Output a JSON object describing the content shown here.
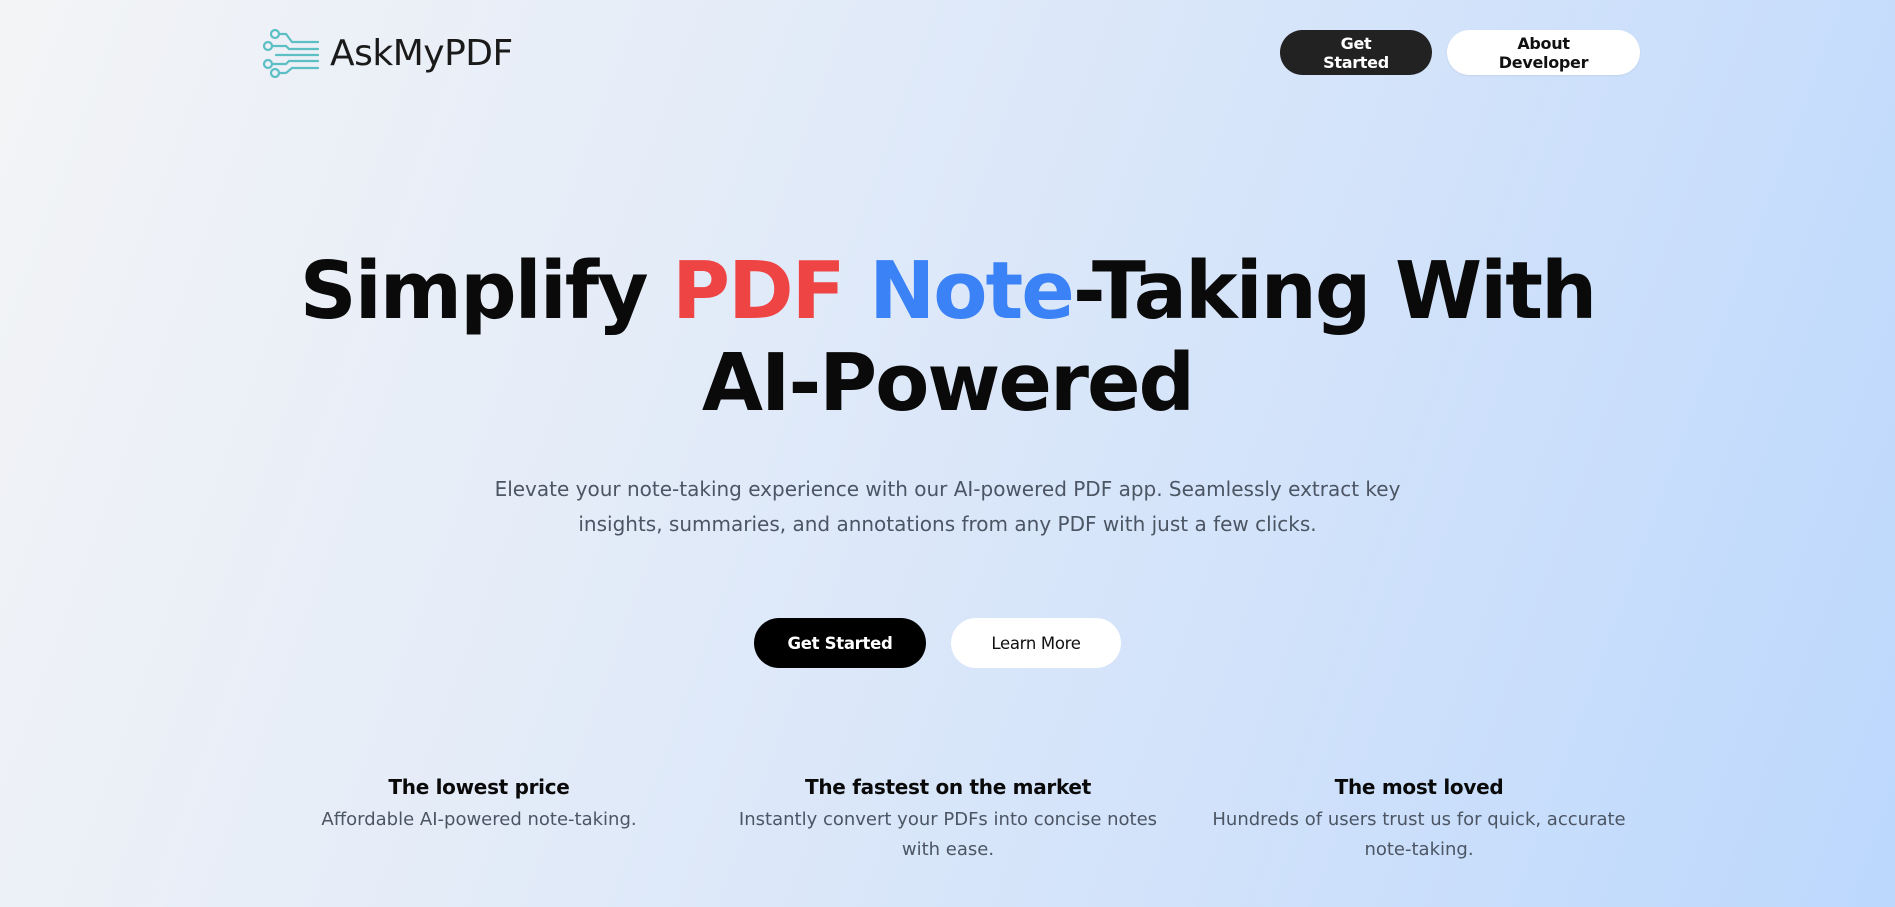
{
  "header": {
    "brand_name": "AskMyPDF",
    "logo_icon": "circuit-lines-icon",
    "accent_color": "#5bbfc4",
    "get_started_label": "Get Started",
    "about_developer_label": "About Developer"
  },
  "hero": {
    "headline": {
      "part1": "Simplify ",
      "red_word": "PDF",
      "space": " ",
      "blue_word": "Note",
      "part2": "-Taking With",
      "line2": "AI-Powered"
    },
    "subtext_line1": "Elevate your note-taking experience with our AI-powered PDF app. Seamlessly extract key",
    "subtext_line2": "insights, summaries, and annotations from any PDF with just a few clicks.",
    "primary_cta": "Get Started",
    "secondary_cta": "Learn More",
    "colors": {
      "red": "#ef4444",
      "blue": "#3b82f6"
    }
  },
  "features": [
    {
      "title": "The lowest price",
      "desc_line1": "Affordable AI-powered note-taking.",
      "desc_line2": ""
    },
    {
      "title": "The fastest on the market",
      "desc_line1": "Instantly convert your PDFs into concise notes",
      "desc_line2": "with ease."
    },
    {
      "title": "The most loved",
      "desc_line1": "Hundreds of users trust us for quick, accurate",
      "desc_line2": "note-taking."
    }
  ]
}
